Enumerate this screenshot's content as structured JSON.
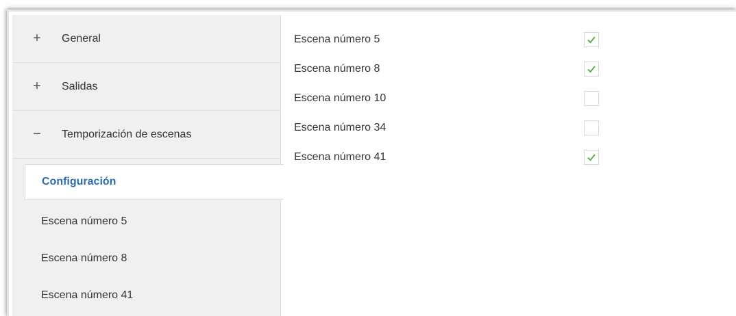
{
  "sidebar": {
    "items": [
      {
        "sign": "+",
        "label": "General"
      },
      {
        "sign": "+",
        "label": "Salidas"
      },
      {
        "sign": "−",
        "label": "Temporización de escenas"
      }
    ],
    "subitems": [
      {
        "label": "Configuración",
        "active": true
      },
      {
        "label": "Escena número 5"
      },
      {
        "label": "Escena número 8"
      },
      {
        "label": "Escena número 41"
      }
    ]
  },
  "main": {
    "rows": [
      {
        "label": "Escena número 5",
        "checked": true
      },
      {
        "label": "Escena número 8",
        "checked": true
      },
      {
        "label": "Escena número 10",
        "checked": false
      },
      {
        "label": "Escena número 34",
        "checked": false
      },
      {
        "label": "Escena número 41",
        "checked": true
      }
    ]
  },
  "colors": {
    "accent": "#2a6db0",
    "check": "#6aa84f"
  }
}
